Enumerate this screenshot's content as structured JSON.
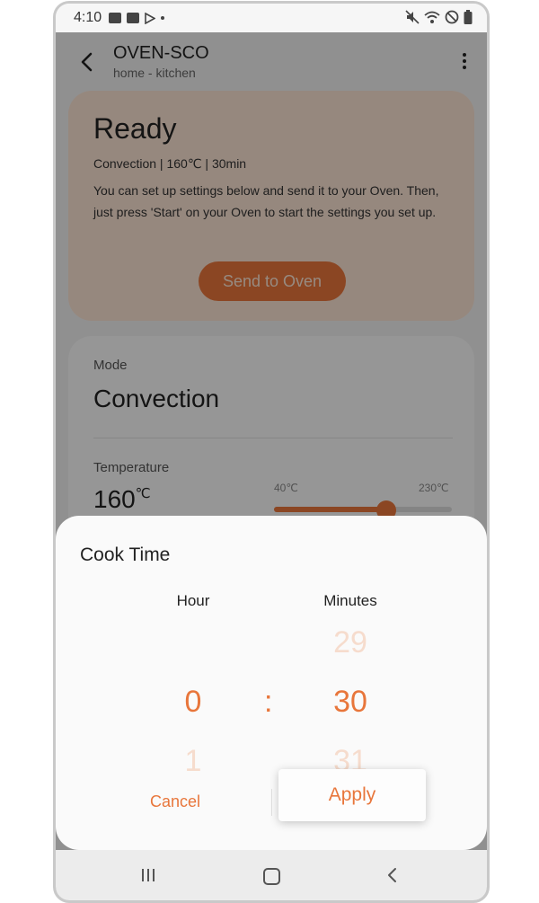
{
  "status_bar": {
    "time": "4:10",
    "left_icons": [
      "gallery-icon",
      "youtube-icon",
      "play-store-icon",
      "dot-icon"
    ],
    "right_icons": [
      "mute-icon",
      "wifi-icon",
      "do-not-disturb-icon",
      "battery-icon"
    ]
  },
  "header": {
    "title": "OVEN-SCO",
    "subtitle": "home - kitchen"
  },
  "status_card": {
    "title": "Ready",
    "summary": "Convection | 160℃ | 30min",
    "description": "You can set up settings below and send it to your Oven. Then, just press 'Start' on your Oven to start the settings you set up.",
    "send_label": "Send to Oven"
  },
  "settings": {
    "mode_label": "Mode",
    "mode_value": "Convection",
    "temperature_label": "Temperature",
    "temperature_value": "160",
    "temperature_unit": "℃",
    "slider_min": "40℃",
    "slider_max": "230℃",
    "slider_fraction": 0.63
  },
  "sheet": {
    "title": "Cook Time",
    "hour_label": "Hour",
    "minutes_label": "Minutes",
    "hour_selected": "0",
    "hour_next": "1",
    "separator": ":",
    "minute_prev": "29",
    "minute_selected": "30",
    "minute_next": "31",
    "cancel_label": "Cancel",
    "apply_label": "Apply"
  },
  "colors": {
    "accent": "#e8763b",
    "status_card_bg": "#fbe3d3"
  }
}
